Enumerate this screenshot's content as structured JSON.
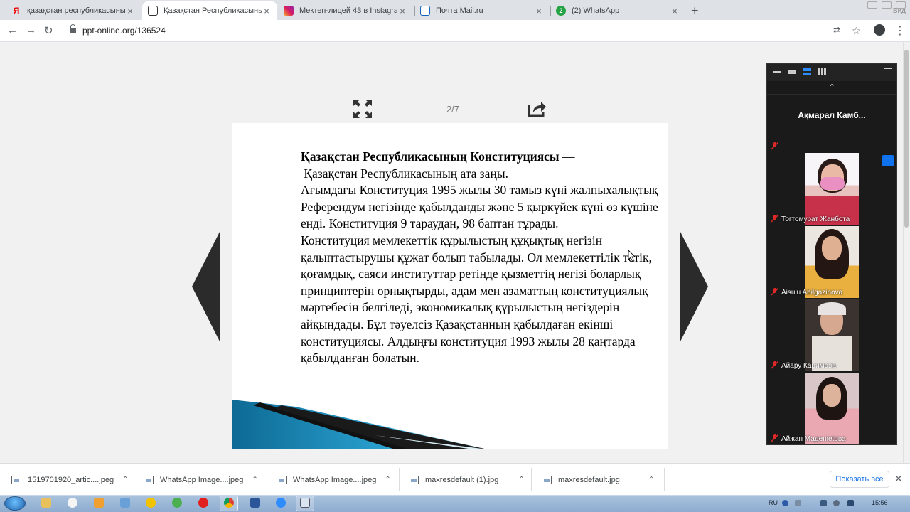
{
  "tabs": [
    {
      "title": "қазақстан республикасының ко",
      "favicon": "yandex-icon",
      "favicon_text": "Я",
      "active": false
    },
    {
      "title": "Қазақстан Республикасының К",
      "favicon": "ppt-online-icon",
      "favicon_text": "",
      "active": true
    },
    {
      "title": "Мектеп-лицей 43 в Instagram: «",
      "favicon": "instagram-icon",
      "favicon_text": "",
      "active": false
    },
    {
      "title": "Почта Mail.ru",
      "favicon": "mail-icon",
      "favicon_text": "",
      "active": false
    },
    {
      "title": "(2) WhatsApp",
      "favicon": "whatsapp-icon",
      "favicon_text": "2",
      "active": false
    }
  ],
  "window": {
    "vid_label": "Вид"
  },
  "address": {
    "url": "ppt-online.org/136524"
  },
  "viewer": {
    "page_counter": "2/7",
    "slide": {
      "title_bold": "Қазақстан Республикасының Конституциясы",
      "title_dash": " —",
      "line_2": " Қазақстан Республикасының ата заңы.",
      "paragraph_1": "Ағымдағы Конституция 1995 жылы 30 тамыз күні жалпыхалықтық Референдум негізінде қабылданды және 5 қыркүйек күні өз күшіне енді. Конституция 9 тараудан, 98 баптан тұрады.",
      "paragraph_2": "Конституция мемлекеттік құрылыстың құқықтық негізін қалыптастырушы құжат болып табылады. Ол мемлекеттілік тетік, қоғамдық, саяси институттар ретінде қызметтің негізі боларлық принциптерін орнықтырды, адам мен азаматтың конституциялық мәртебесін белгіледі, экономикалық құрылыстың негіздерін айқындады. Бұл тәуелсіз Қазақстанның қабылдаған екінші конституциясы. Алдыңғы конституция 1993 жылы 28 қаңтарда қабылданған болатын."
    }
  },
  "zoom": {
    "host_name": "Ақмарал Камб...",
    "participants": [
      {
        "name": "Тогтомурат Жанбота"
      },
      {
        "name": "Aisulu Abilgazinova"
      },
      {
        "name": "Айару Каримова"
      },
      {
        "name": "Айжан Маденietова"
      }
    ],
    "more_label": "···"
  },
  "downloads": [
    {
      "name": "1519701920_artic....jpeg"
    },
    {
      "name": "WhatsApp Image....jpeg"
    },
    {
      "name": "WhatsApp Image....jpeg"
    },
    {
      "name": "maxresdefault (1).jpg"
    },
    {
      "name": "maxresdefault.jpg"
    }
  ],
  "downloads_bar": {
    "show_all": "Показать все"
  },
  "taskbar": {
    "lang": "RU",
    "clock": "15:56"
  },
  "colors": {
    "accent": "#1a73e8",
    "zoom_bg": "#1a1a1a",
    "zoom_blue": "#0e72ed",
    "slide_teal": "#1e88b4"
  }
}
